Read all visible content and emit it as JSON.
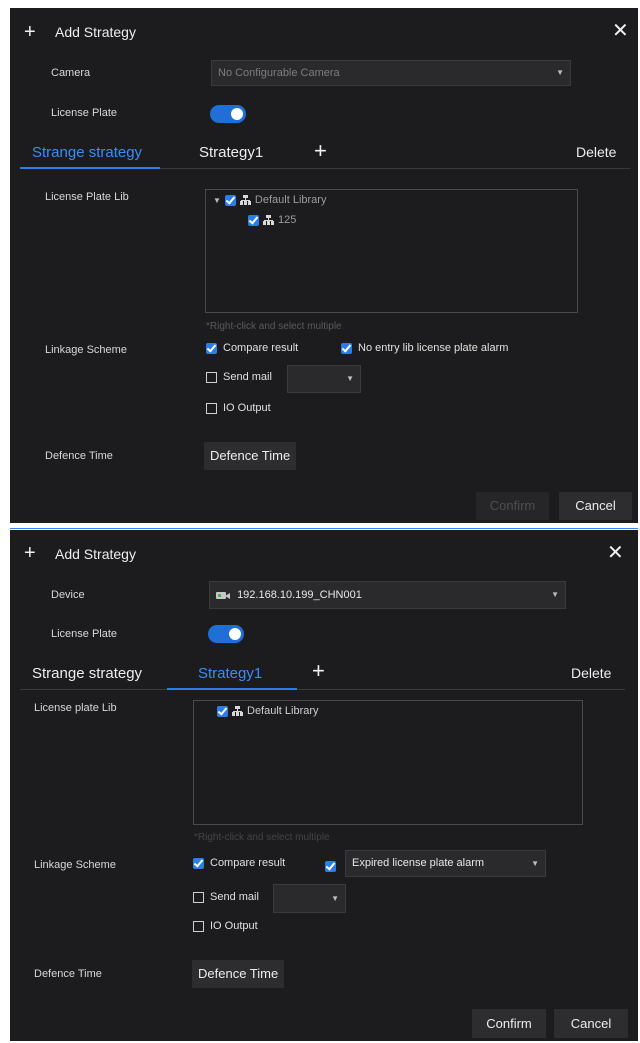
{
  "dialog1": {
    "title": "Add Strategy",
    "camera_label": "Camera",
    "camera_value": "No Configurable Camera",
    "license_plate_label": "License Plate",
    "tabs": [
      "Strange strategy",
      "Strategy1"
    ],
    "active_tab": 0,
    "delete_label": "Delete",
    "lib_label": "License Plate Lib",
    "tree": [
      {
        "label": "Default Library"
      },
      {
        "label": "125"
      }
    ],
    "hint": "*Right-click and select multiple",
    "linkage_label": "Linkage Scheme",
    "compare_result": "Compare result",
    "no_entry_alarm": "No entry lib license plate alarm",
    "send_mail": "Send mail",
    "send_mail_value": "",
    "io_output": "IO Output",
    "defence_label": "Defence Time",
    "defence_button": "Defence Time",
    "confirm": "Confirm",
    "cancel": "Cancel"
  },
  "dialog2": {
    "title": "Add Strategy",
    "device_label": "Device",
    "device_value": "192.168.10.199_CHN001",
    "license_plate_label": "License Plate",
    "tabs": [
      "Strange strategy",
      "Strategy1"
    ],
    "active_tab": 1,
    "delete_label": "Delete",
    "lib_label": "License plate Lib",
    "tree": [
      {
        "label": "Default Library"
      }
    ],
    "hint": "*Right-click and select multiple",
    "linkage_label": "Linkage Scheme",
    "compare_result": "Compare result",
    "alarm_select_value": "Expired license plate alarm",
    "send_mail": "Send mail",
    "send_mail_value": "",
    "io_output": "IO Output",
    "defence_label": "Defence Time",
    "defence_button": "Defence Time",
    "confirm": "Confirm",
    "cancel": "Cancel"
  },
  "colors": {
    "background": "#1c1c1e",
    "accent": "#2b7de9",
    "active_tab": "#3b8df5",
    "separator": "#3b82f6"
  }
}
